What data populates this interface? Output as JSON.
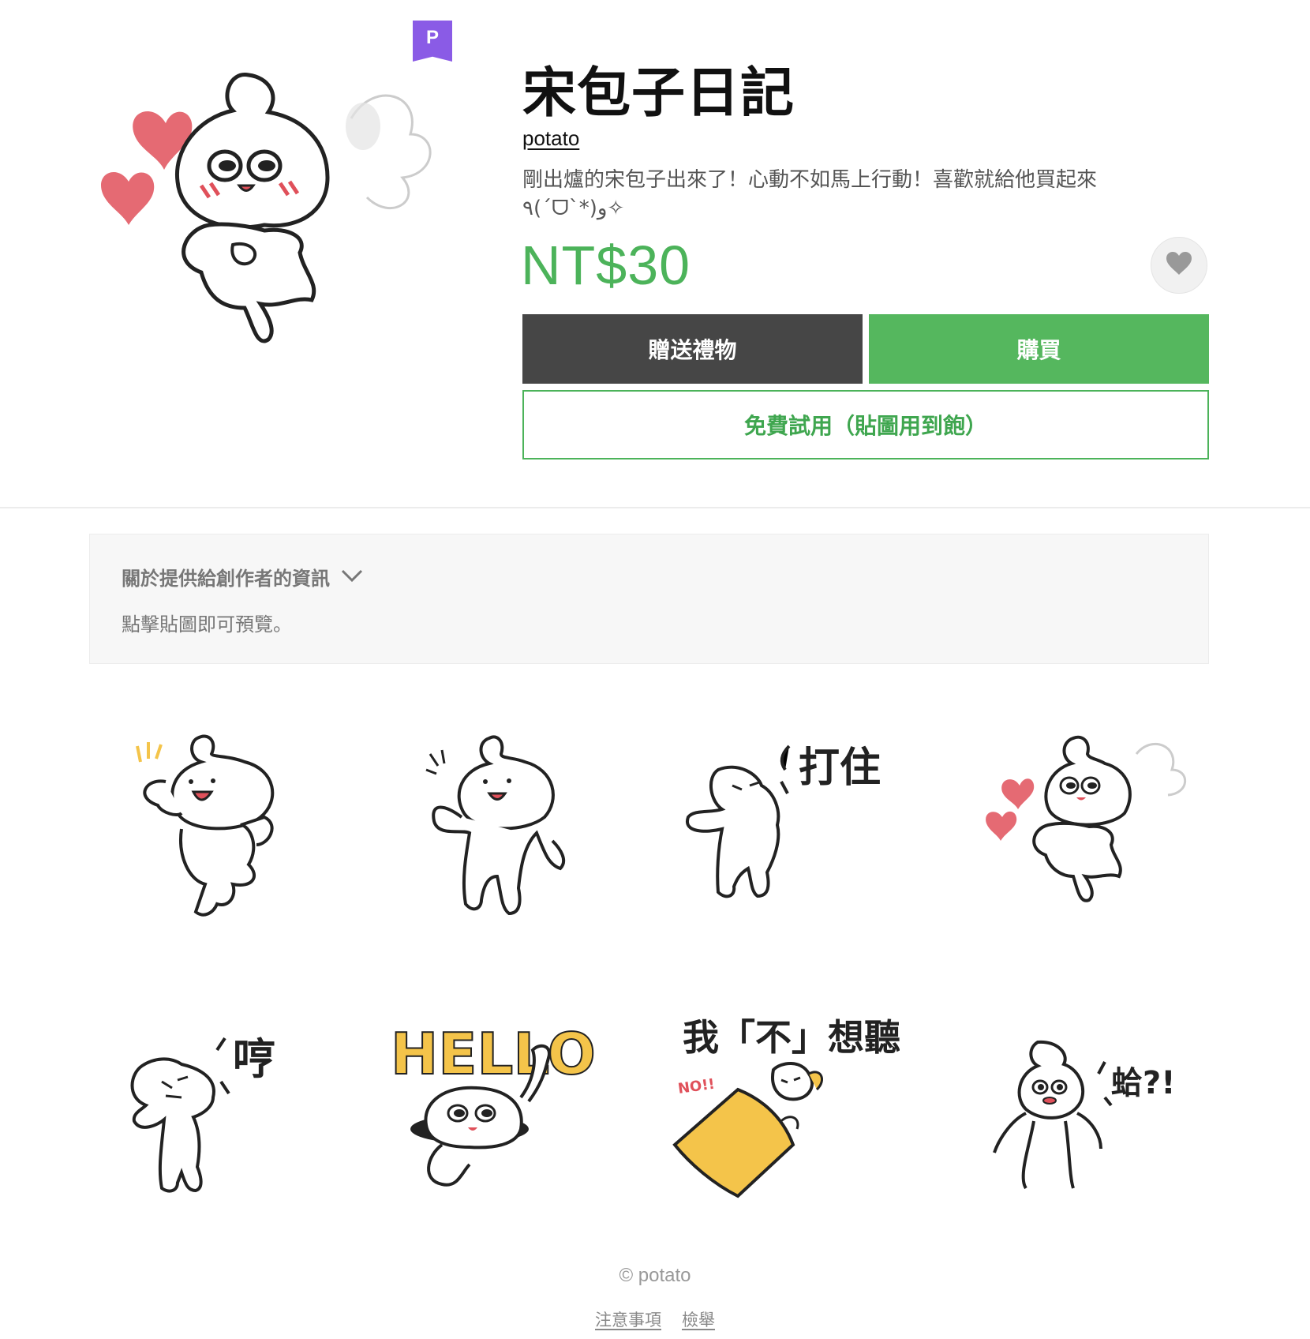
{
  "product": {
    "badge": "P",
    "title": "宋包子日記",
    "author": "potato",
    "description": "剛出爐的宋包子出來了！心動不如馬上行動！喜歡就給他買起來٩(ˊᗜˋ*)و✧",
    "price": "NT$30"
  },
  "actions": {
    "gift_label": "贈送禮物",
    "buy_label": "購買",
    "trial_label": "免費試用（貼圖用到飽）"
  },
  "info": {
    "toggle_label": "關於提供給創作者的資訊",
    "hint": "點擊貼圖即可預覽。"
  },
  "stickers": {
    "texts": {
      "s3": "打住",
      "s5": "哼",
      "s6": "HELLO",
      "s7": "我「不」想聽",
      "s7_small": "NO!!",
      "s8": "蛤?!"
    }
  },
  "footer": {
    "copyright": "© potato",
    "links": [
      "注意事項",
      "檢舉"
    ]
  },
  "colors": {
    "accent_green": "#4cb35a",
    "gift_dark": "#464646",
    "badge_purple": "#8a5be6",
    "heart_red": "#e0505a",
    "hello_yellow": "#f4c44a"
  }
}
